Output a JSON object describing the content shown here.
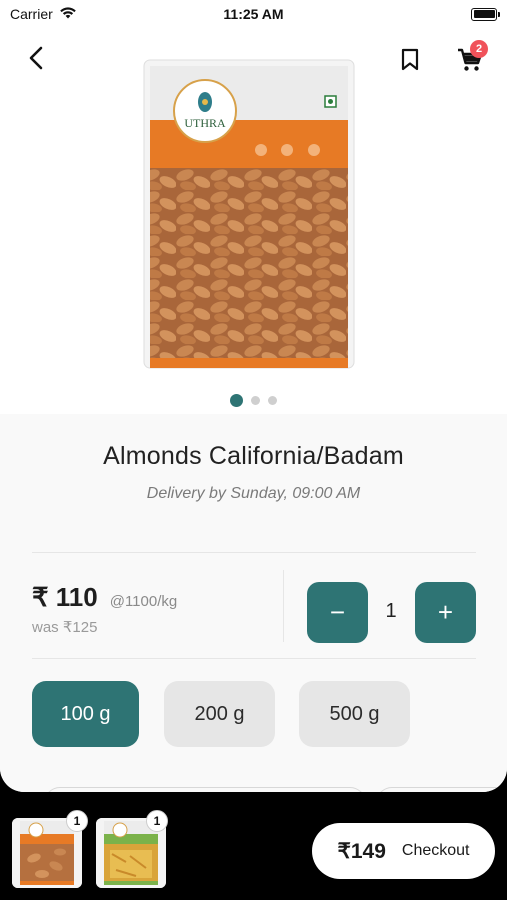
{
  "status_bar": {
    "carrier": "Carrier",
    "time": "11:25 AM"
  },
  "header": {
    "cart_count": "2"
  },
  "product_image": {
    "brand": "UTHRA",
    "carousel_total": 3,
    "carousel_active": 0
  },
  "product": {
    "title": "Almonds California/Badam",
    "delivery": "Delivery by Sunday, 09:00 AM",
    "price": "₹ 110",
    "unit_price": "@1100/kg",
    "was_price": "was ₹125"
  },
  "quantity": {
    "minus_label": "−",
    "value": "1",
    "plus_label": "+"
  },
  "sizes": [
    {
      "label": "100 g",
      "selected": true
    },
    {
      "label": "200 g",
      "selected": false
    },
    {
      "label": "500 g",
      "selected": false
    }
  ],
  "cart_bar": {
    "items": [
      {
        "qty": "1"
      },
      {
        "qty": "1"
      }
    ],
    "total": "₹149",
    "checkout_label": "Checkout"
  },
  "colors": {
    "accent": "#2e7474",
    "badge": "#f0525a",
    "bag_orange": "#e77a25"
  }
}
